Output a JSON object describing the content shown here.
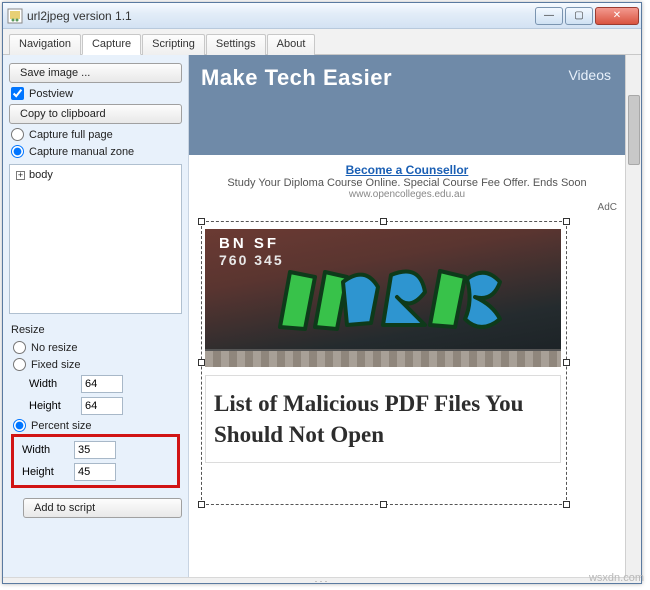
{
  "window": {
    "title": "url2jpeg version 1.1"
  },
  "tabs": {
    "items": [
      {
        "label": "Navigation"
      },
      {
        "label": "Capture"
      },
      {
        "label": "Scripting"
      },
      {
        "label": "Settings"
      },
      {
        "label": "About"
      }
    ],
    "active_index": 1
  },
  "sidebar": {
    "save_image_btn": "Save image ...",
    "postview_checkbox": "Postview",
    "copy_clipboard_btn": "Copy to clipboard",
    "capture_full_page": "Capture full page",
    "capture_manual_zone": "Capture manual zone",
    "tree_root": "body",
    "resize": {
      "title": "Resize",
      "no_resize": "No resize",
      "fixed_size": "Fixed size",
      "fixed_width_label": "Width",
      "fixed_width_value": "64",
      "fixed_height_label": "Height",
      "fixed_height_value": "64",
      "percent_size": "Percent size",
      "pct_width_label": "Width",
      "pct_width_value": "35",
      "pct_height_label": "Height",
      "pct_height_value": "45"
    },
    "add_to_script_btn": "Add to script"
  },
  "preview": {
    "hero_title": "Make Tech Easier",
    "hero_right_link": "Videos",
    "ad_link": "Become a Counsellor",
    "ad_text": "Study Your Diploma Course Online. Special Course Fee Offer. Ends Soon",
    "ad_domain": "www.opencolleges.edu.au",
    "ad_label": "AdC",
    "boxcar_line1": "BN SF",
    "boxcar_line2": "760 345",
    "article_title": "List of Malicious PDF Files You Should Not Open"
  },
  "watermark": "wsxdn.com"
}
